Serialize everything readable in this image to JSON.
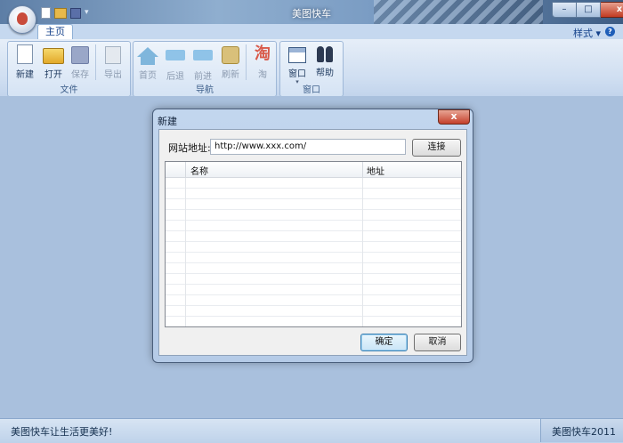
{
  "window": {
    "title": "美图快车",
    "controls": {
      "minimize": "–",
      "maximize": "□",
      "close": "x"
    }
  },
  "ribbon": {
    "tabs": [
      {
        "label": "主页",
        "active": true
      }
    ],
    "style_menu": "样式",
    "help_icon_glyph": "?",
    "groups": [
      {
        "label": "文件",
        "buttons": [
          {
            "label": "新建",
            "icon": "new-document-icon",
            "enabled": true
          },
          {
            "label": "打开",
            "icon": "folder-open-icon",
            "enabled": true
          },
          {
            "label": "保存",
            "icon": "save-icon",
            "enabled": false
          },
          {
            "label": "导出",
            "icon": "export-icon",
            "enabled": false
          }
        ]
      },
      {
        "label": "导航",
        "buttons": [
          {
            "label": "首页",
            "icon": "home-icon",
            "enabled": false
          },
          {
            "label": "后退",
            "icon": "back-arrow-icon",
            "enabled": false
          },
          {
            "label": "前进",
            "icon": "forward-arrow-icon",
            "enabled": false
          },
          {
            "label": "刷新",
            "icon": "refresh-icon",
            "enabled": false
          },
          {
            "label": "淘",
            "icon": "taobao-icon",
            "enabled": false,
            "glyph": "淘"
          }
        ]
      },
      {
        "label": "窗口",
        "buttons": [
          {
            "label": "窗口",
            "icon": "window-icon",
            "enabled": true,
            "has_dropdown": true
          },
          {
            "label": "帮助",
            "icon": "binoculars-help-icon",
            "enabled": true
          }
        ]
      }
    ]
  },
  "dialog": {
    "title": "新建",
    "close_glyph": "x",
    "url_label": "网站地址:",
    "url_value": "http://www.xxx.com/",
    "connect_label": "连接",
    "table": {
      "columns": [
        "名称",
        "地址"
      ],
      "rows": []
    },
    "ok_label": "确定",
    "cancel_label": "取消"
  },
  "statusbar": {
    "left_text": "美图快车让生活更美好!",
    "right_text": "美图快车2011"
  }
}
